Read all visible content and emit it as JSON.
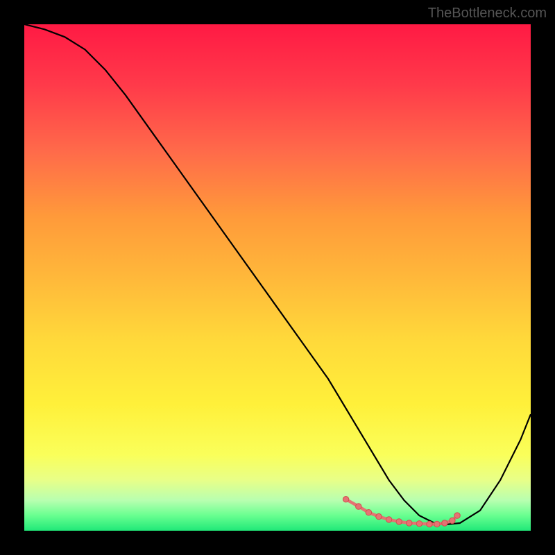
{
  "watermark": "TheBottleneck.com",
  "chart_data": {
    "type": "line",
    "title": "",
    "xlabel": "",
    "ylabel": "",
    "xlim": [
      0,
      100
    ],
    "ylim": [
      0,
      100
    ],
    "series": [
      {
        "name": "curve",
        "x": [
          0,
          4,
          8,
          12,
          16,
          20,
          25,
          30,
          35,
          40,
          45,
          50,
          55,
          60,
          63,
          66,
          69,
          72,
          75,
          78,
          81,
          83,
          86,
          90,
          94,
          98,
          100
        ],
        "values": [
          100,
          99,
          97.5,
          95,
          91,
          86,
          79,
          72,
          65,
          58,
          51,
          44,
          37,
          30,
          25,
          20,
          15,
          10,
          6,
          3,
          1.5,
          1.2,
          1.5,
          4,
          10,
          18,
          23
        ]
      }
    ],
    "markers": {
      "name": "highlight",
      "x": [
        63.5,
        66,
        68,
        70,
        72,
        74,
        76,
        78,
        80,
        81.5,
        83,
        84.5,
        85.5
      ],
      "values": [
        6.2,
        4.8,
        3.6,
        2.8,
        2.2,
        1.8,
        1.5,
        1.4,
        1.3,
        1.3,
        1.5,
        2.0,
        3.0
      ]
    },
    "background_gradient": {
      "stops": [
        {
          "pos": 0,
          "color": "#ff1a44"
        },
        {
          "pos": 25,
          "color": "#ff6a4a"
        },
        {
          "pos": 50,
          "color": "#ffb83a"
        },
        {
          "pos": 75,
          "color": "#fff03a"
        },
        {
          "pos": 94,
          "color": "#b8ffb0"
        },
        {
          "pos": 100,
          "color": "#20e878"
        }
      ]
    }
  }
}
